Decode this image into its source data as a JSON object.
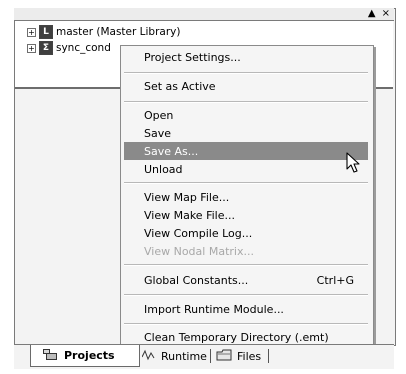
{
  "panel": {
    "controls": {
      "pin": "▲",
      "close": "×"
    }
  },
  "tree": {
    "items": [
      {
        "label": "master (Master Library)",
        "icon_text": "L",
        "expander": "+"
      },
      {
        "label": "sync_cond",
        "icon_text": "Σ",
        "expander": "+"
      }
    ]
  },
  "context_menu": {
    "items": [
      {
        "label": "Project Settings...",
        "shortcut": "",
        "state": "normal"
      },
      {
        "label": "Set as Active",
        "shortcut": "",
        "state": "normal"
      },
      {
        "label": "Open",
        "shortcut": "",
        "state": "normal"
      },
      {
        "label": "Save",
        "shortcut": "",
        "state": "normal"
      },
      {
        "label": "Save As...",
        "shortcut": "",
        "state": "selected"
      },
      {
        "label": "Unload",
        "shortcut": "",
        "state": "normal"
      },
      {
        "label": "View Map File...",
        "shortcut": "",
        "state": "normal"
      },
      {
        "label": "View Make File...",
        "shortcut": "",
        "state": "normal"
      },
      {
        "label": "View Compile Log...",
        "shortcut": "",
        "state": "normal"
      },
      {
        "label": "View Nodal Matrix...",
        "shortcut": "",
        "state": "disabled"
      },
      {
        "label": "Global Constants...",
        "shortcut": "Ctrl+G",
        "state": "normal"
      },
      {
        "label": "Import Runtime Module...",
        "shortcut": "",
        "state": "normal"
      },
      {
        "label": "Clean Temporary Directory (.emt)",
        "shortcut": "",
        "state": "normal"
      }
    ]
  },
  "tabs": [
    {
      "label": "Projects",
      "icon": "projects-icon",
      "active": true
    },
    {
      "label": "Runtime",
      "icon": "runtime-icon",
      "active": false
    },
    {
      "label": "Files",
      "icon": "files-icon",
      "active": false
    }
  ],
  "colors": {
    "highlight": "#8a8a8a",
    "menu_bg": "#f5f5f5"
  }
}
